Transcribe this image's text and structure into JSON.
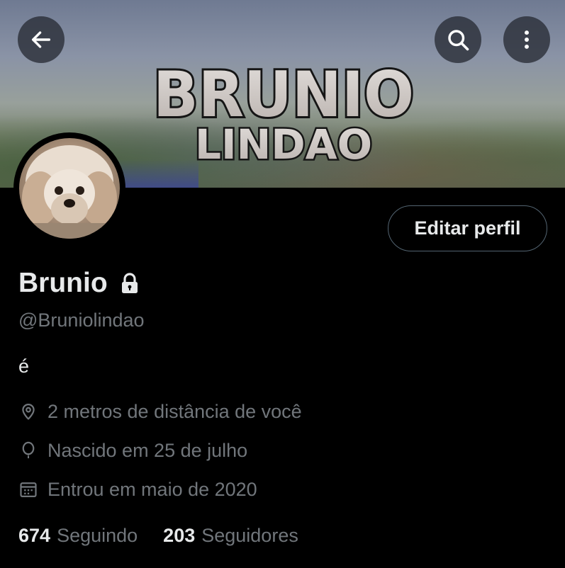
{
  "header": {
    "banner_text_line1": "BRUNIO",
    "banner_text_line2": "LINDAO"
  },
  "icons": {
    "back": "arrow-left-icon",
    "search": "search-icon",
    "more": "more-vertical-icon",
    "lock": "lock-icon",
    "location": "location-pin-icon",
    "birth": "balloon-icon",
    "joined": "calendar-icon"
  },
  "profile": {
    "edit_label": "Editar perfil",
    "name": "Brunio",
    "handle": "@Bruniolindao",
    "bio": "é",
    "location": "2 metros de distância de você",
    "birth": "Nascido em 25 de julho",
    "joined": "Entrou em maio de 2020",
    "following_count": "674",
    "following_label": "Seguindo",
    "followers_count": "203",
    "followers_label": "Seguidores"
  },
  "colors": {
    "background": "#000000",
    "text_primary": "#e7e9ea",
    "text_secondary": "#71767b",
    "button_border": "#536471"
  }
}
